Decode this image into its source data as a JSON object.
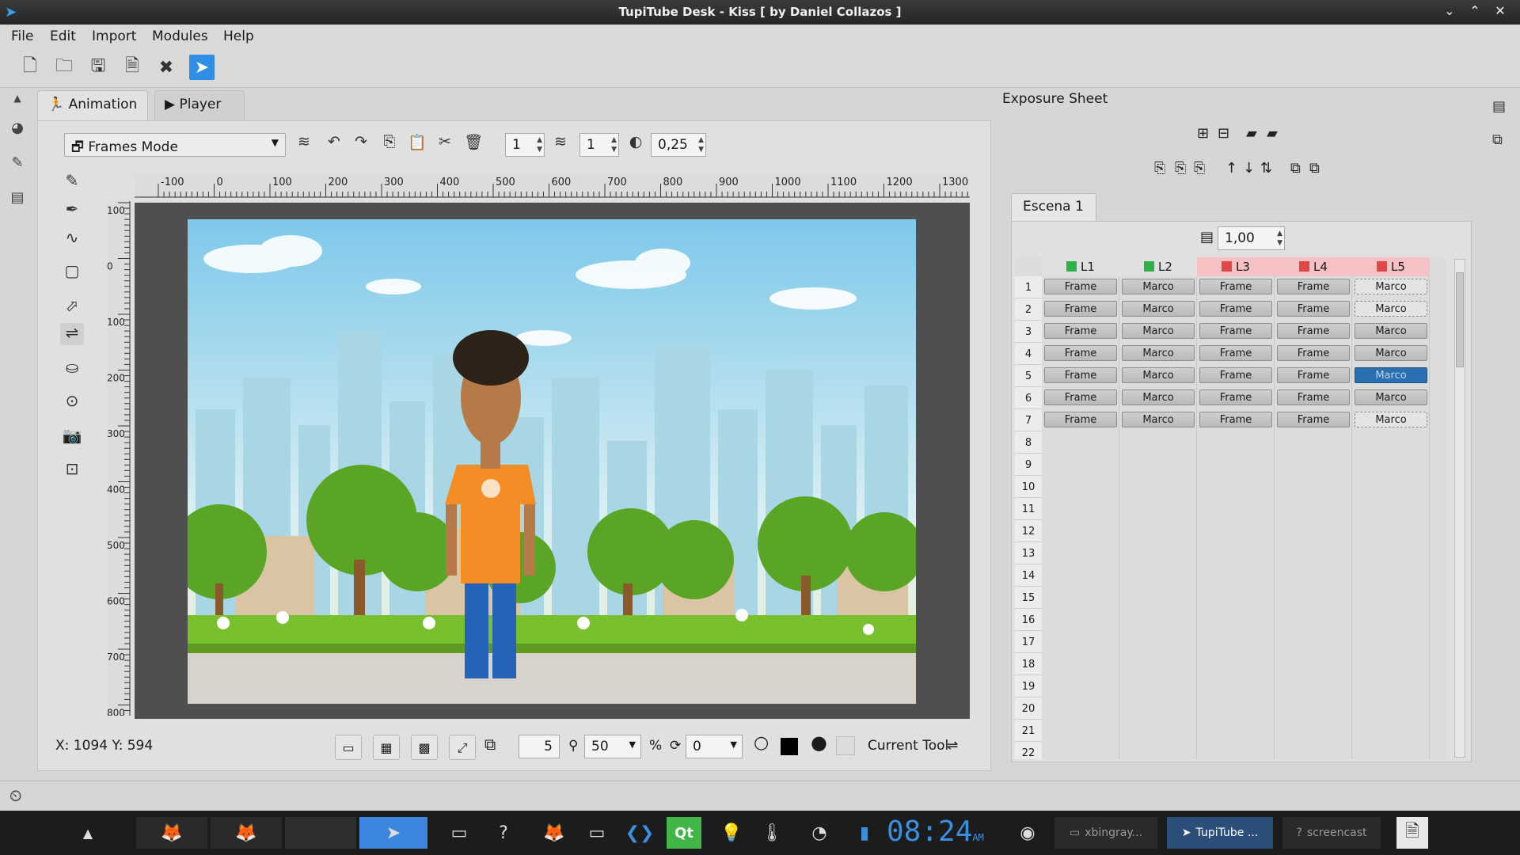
{
  "window": {
    "title": "TupiTube Desk - Kiss [ by Daniel Collazos ]"
  },
  "menu": [
    "File",
    "Edit",
    "Import",
    "Modules",
    "Help"
  ],
  "tabs": {
    "animation": "Animation",
    "player": "Player"
  },
  "anim_toolbar": {
    "mode": "Frames Mode",
    "spin1": "1",
    "spin2": "1",
    "opacity": "0,25"
  },
  "ruler_h": [
    "-100",
    "0",
    "100",
    "200",
    "300",
    "400",
    "500",
    "600",
    "700",
    "800",
    "900",
    "1000",
    "1100",
    "1200",
    "1300"
  ],
  "ruler_v": [
    "100",
    "0",
    "100",
    "200",
    "300",
    "400",
    "500",
    "600",
    "700",
    "800"
  ],
  "status": {
    "coords": "X: 1094 Y: 594",
    "frame_spin": "5",
    "zoom": "50",
    "zoom_unit": "%",
    "rotation": "0",
    "current_tool": "Current Tool"
  },
  "exposure": {
    "title": "Exposure Sheet",
    "scene": "Escena 1",
    "fps": "1,00",
    "layers": [
      {
        "label": "L1",
        "color": "#2db24a",
        "header_bg": "#e0e0e0"
      },
      {
        "label": "L2",
        "color": "#2db24a",
        "header_bg": "#e0e0e0"
      },
      {
        "label": "L3",
        "color": "#e04848",
        "header_bg": "#f4c2c2"
      },
      {
        "label": "L4",
        "color": "#e04848",
        "header_bg": "#f4c2c2"
      },
      {
        "label": "L5",
        "color": "#e04848",
        "header_bg": "#f4c2c2"
      }
    ],
    "rows": [
      "1",
      "2",
      "3",
      "4",
      "5",
      "6",
      "7",
      "8",
      "9",
      "10",
      "11",
      "12",
      "13",
      "14",
      "15",
      "16",
      "17",
      "18",
      "19",
      "20",
      "21",
      "22"
    ],
    "cells": [
      [
        "Frame",
        "Marco",
        "Frame",
        "Frame",
        "Marco"
      ],
      [
        "Frame",
        "Marco",
        "Frame",
        "Frame",
        "Marco"
      ],
      [
        "Frame",
        "Marco",
        "Frame",
        "Frame",
        "Marco"
      ],
      [
        "Frame",
        "Marco",
        "Frame",
        "Frame",
        "Marco"
      ],
      [
        "Frame",
        "Marco",
        "Frame",
        "Frame",
        "Marco"
      ],
      [
        "Frame",
        "Marco",
        "Frame",
        "Frame",
        "Marco"
      ],
      [
        "Frame",
        "Marco",
        "Frame",
        "Frame",
        "Marco"
      ]
    ]
  },
  "taskbar": {
    "clock": "08:24",
    "ampm": "AM",
    "task1": "xbingray...",
    "task2": "TupiTube ...",
    "task3": "screencast"
  }
}
